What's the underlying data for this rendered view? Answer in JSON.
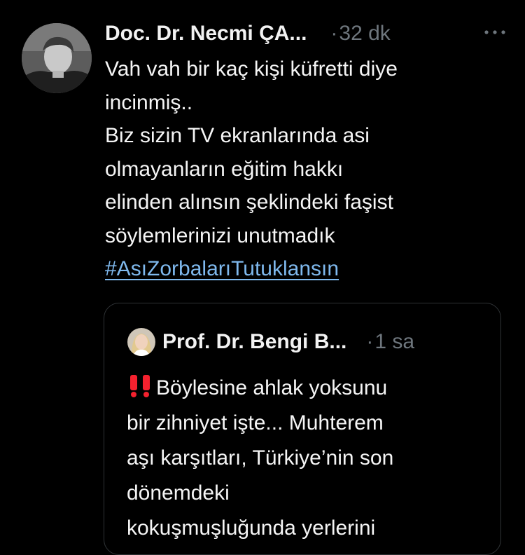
{
  "tweet": {
    "author_name": "Doc. Dr. Necmi ÇA...",
    "time_separator": "·",
    "time_ago": "32 dk",
    "more_icon": "more-horizontal-icon",
    "text_lines": [
      "Vah vah bir kaç kişi küfretti diye",
      "incinmiş..",
      "Biz sizin TV ekranlarında asi",
      "olmayanların eğitim hakkı",
      "elinden alınsın şeklindeki faşist",
      "söylemlerinizi unutmadık"
    ],
    "hashtag": "#AsıZorbalarıTutuklansın"
  },
  "quoted_tweet": {
    "author_name": "Prof. Dr. Bengi B...",
    "time_separator": "·",
    "time_ago": "1 sa",
    "alert_icon": "double-exclamation-icon",
    "text_lines": [
      "Böylesine ahlak yoksunu",
      "bir zihniyet işte... Muhterem",
      "aşı karşıtları, Türkiye’nin son",
      "dönemdeki",
      "kokuşmuşluğunda yerlerini"
    ]
  },
  "colors": {
    "background": "#000000",
    "text": "#f5f5f5",
    "muted": "#6e767d",
    "link": "#7fb9ee",
    "border": "#2f3336",
    "alert": "#f4212e"
  }
}
